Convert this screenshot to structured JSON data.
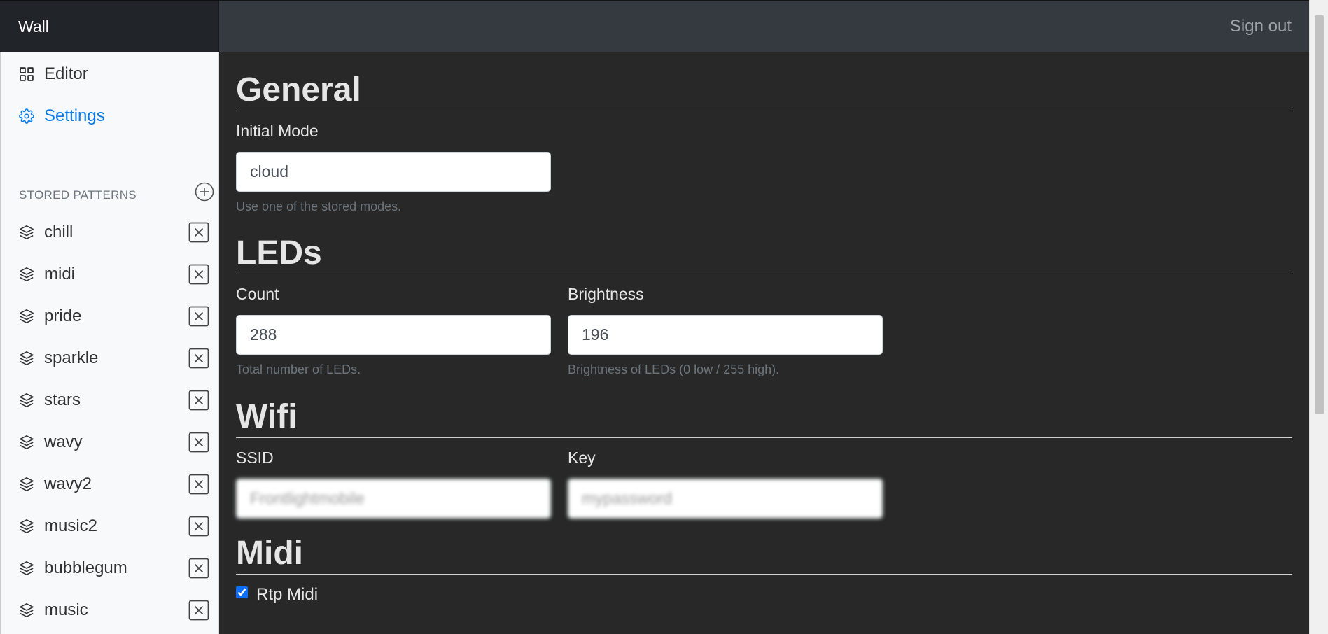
{
  "app": {
    "brand": "Wall",
    "sign_out": "Sign out"
  },
  "nav": [
    {
      "label": "Editor",
      "icon": "grid-icon"
    },
    {
      "label": "Settings",
      "icon": "gear-icon",
      "active": true
    }
  ],
  "stored_patterns": {
    "title": "STORED PATTERNS",
    "items": [
      "chill",
      "midi",
      "pride",
      "sparkle",
      "stars",
      "wavy",
      "wavy2",
      "music2",
      "bubblegum",
      "music"
    ]
  },
  "settings": {
    "general": {
      "heading": "General",
      "initial_mode_label": "Initial Mode",
      "initial_mode_value": "cloud",
      "initial_mode_help": "Use one of the stored modes."
    },
    "leds": {
      "heading": "LEDs",
      "count_label": "Count",
      "count_value": "288",
      "count_help": "Total number of LEDs.",
      "brightness_label": "Brightness",
      "brightness_value": "196",
      "brightness_help": "Brightness of LEDs (0 low / 255 high)."
    },
    "wifi": {
      "heading": "Wifi",
      "ssid_label": "SSID",
      "ssid_value": "Frontlightmobile",
      "key_label": "Key",
      "key_value": "mypassword"
    },
    "midi": {
      "heading": "Midi",
      "rtp_midi_label": "Rtp Midi",
      "rtp_midi_checked": true
    }
  },
  "colors": {
    "accent": "#0d7ce9",
    "topbar": "#343a40",
    "brand_bg": "#212529",
    "main_bg": "#282828",
    "sidebar_bg": "#f8f9fa"
  }
}
